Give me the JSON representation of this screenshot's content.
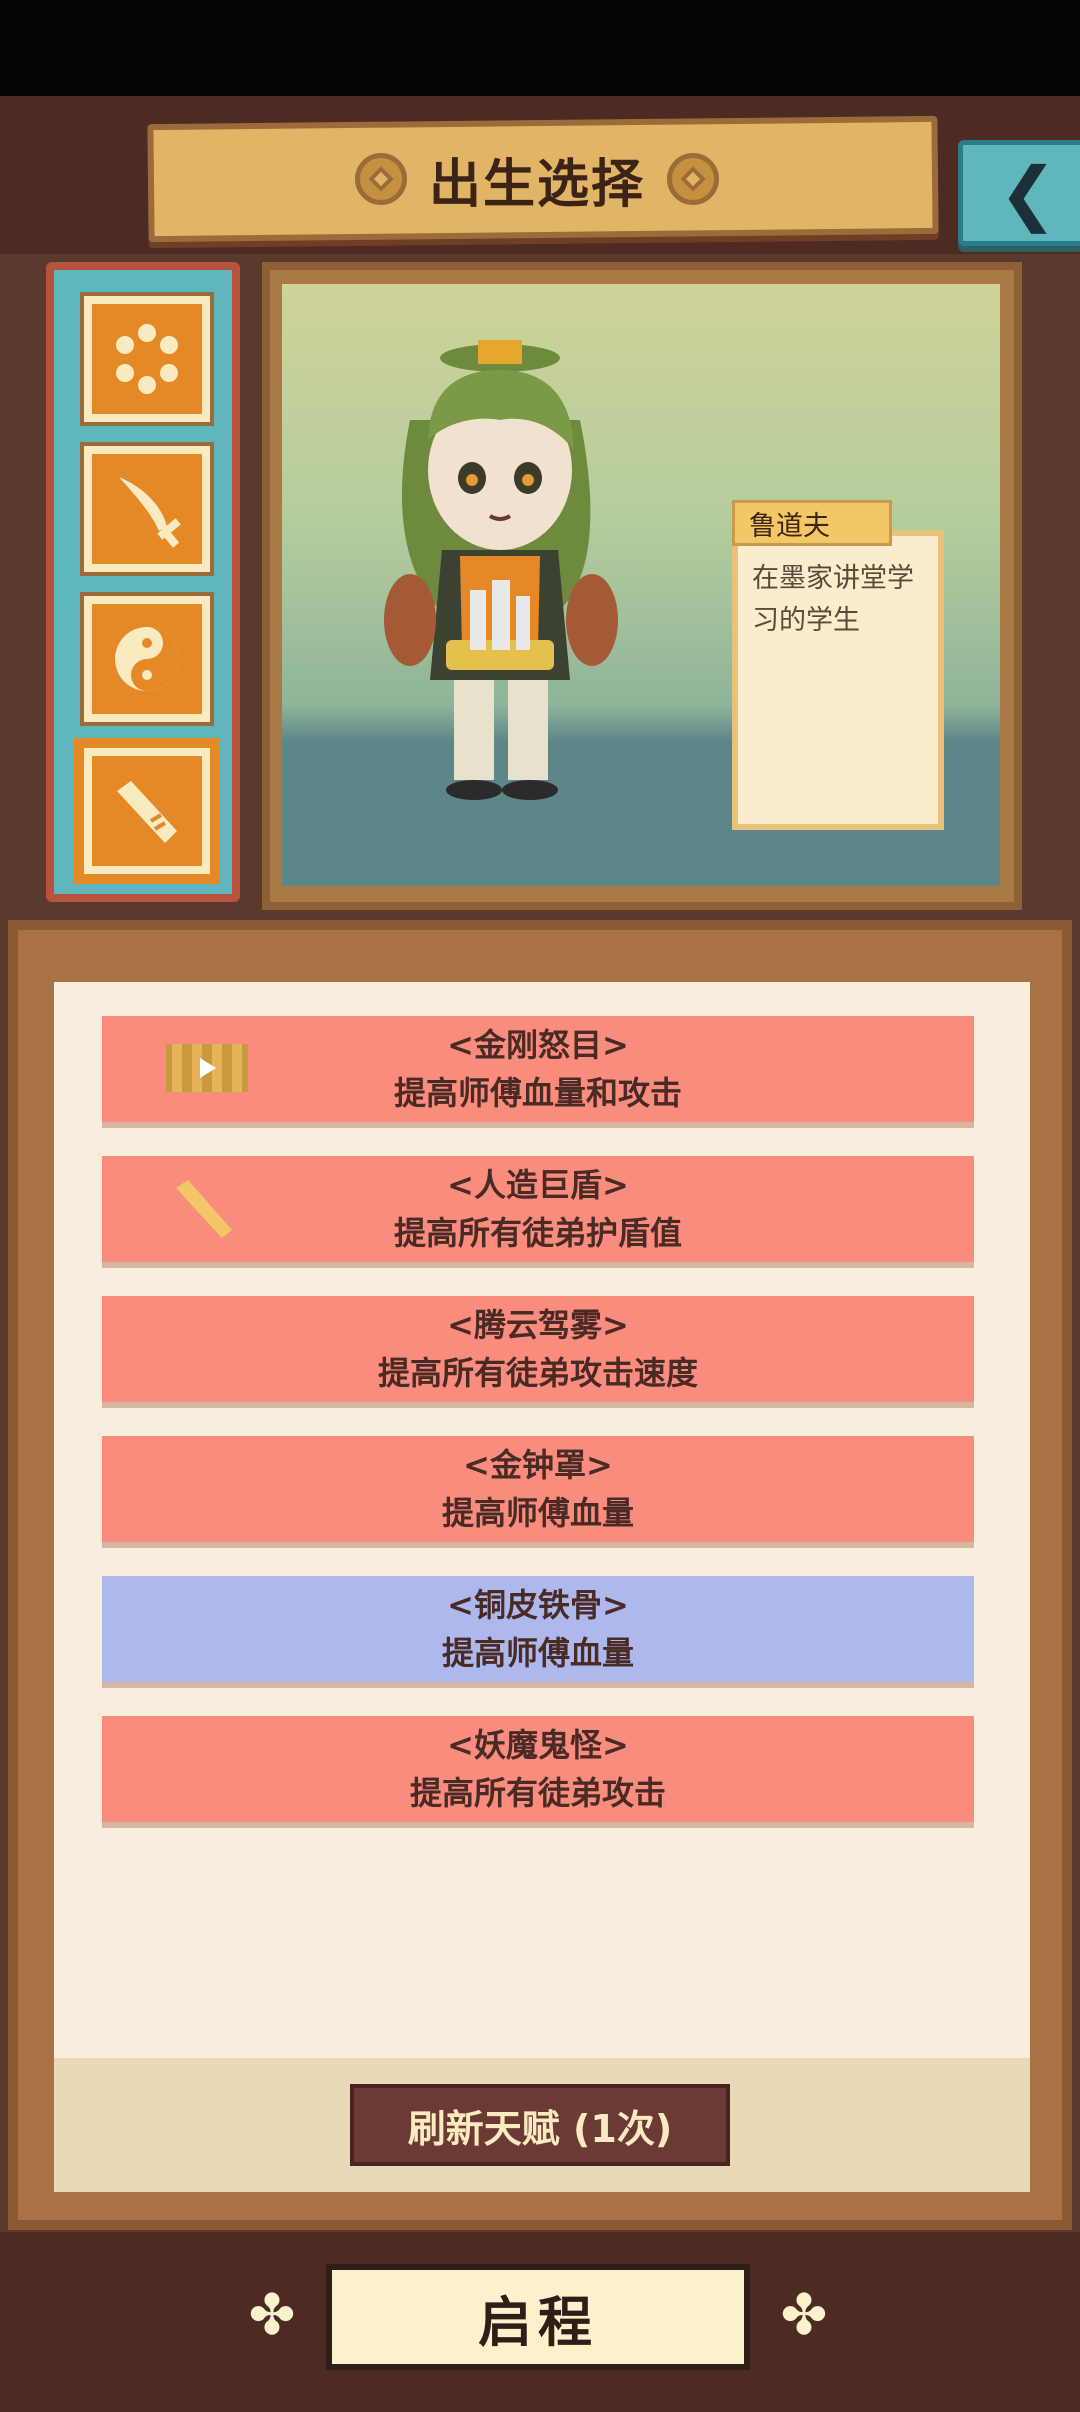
{
  "header": {
    "title": "出生选择",
    "back_icon": "chevron-left-icon"
  },
  "tabs": [
    {
      "icon": "beads-icon",
      "selected": false
    },
    {
      "icon": "sword-icon",
      "selected": false
    },
    {
      "icon": "yin-yang-icon",
      "selected": false
    },
    {
      "icon": "scroll-tool-icon",
      "selected": true
    }
  ],
  "character": {
    "name": "鲁道夫",
    "description": "在墨家讲堂学习的学生"
  },
  "talents": [
    {
      "name": "<金刚怒目>",
      "effect": "提高师傅血量和攻击",
      "icon": "bamboo-scroll-icon",
      "color": "#f98c7d"
    },
    {
      "name": "<人造巨盾>",
      "effect": "提高所有徒弟护盾值",
      "icon": "scroll-tool-icon",
      "color": "#f98c7d"
    },
    {
      "name": "<腾云驾雾>",
      "effect": "提高所有徒弟攻击速度",
      "icon": "",
      "color": "#f98c7d"
    },
    {
      "name": "<金钟罩>",
      "effect": "提高师傅血量",
      "icon": "",
      "color": "#f98c7d"
    },
    {
      "name": "<铜皮铁骨>",
      "effect": "提高师傅血量",
      "icon": "",
      "color": "#adb9ed"
    },
    {
      "name": "<妖魔鬼怪>",
      "effect": "提高所有徒弟攻击",
      "icon": "",
      "color": "#f98c7d"
    }
  ],
  "refresh_button": "刷新天赋 (1次)",
  "start_button": "启程",
  "colors": {
    "talent_red": "#f98c7d",
    "talent_blue": "#adb9ed",
    "frame_brown": "#4d2b23",
    "accent_teal": "#5fb7bd"
  }
}
